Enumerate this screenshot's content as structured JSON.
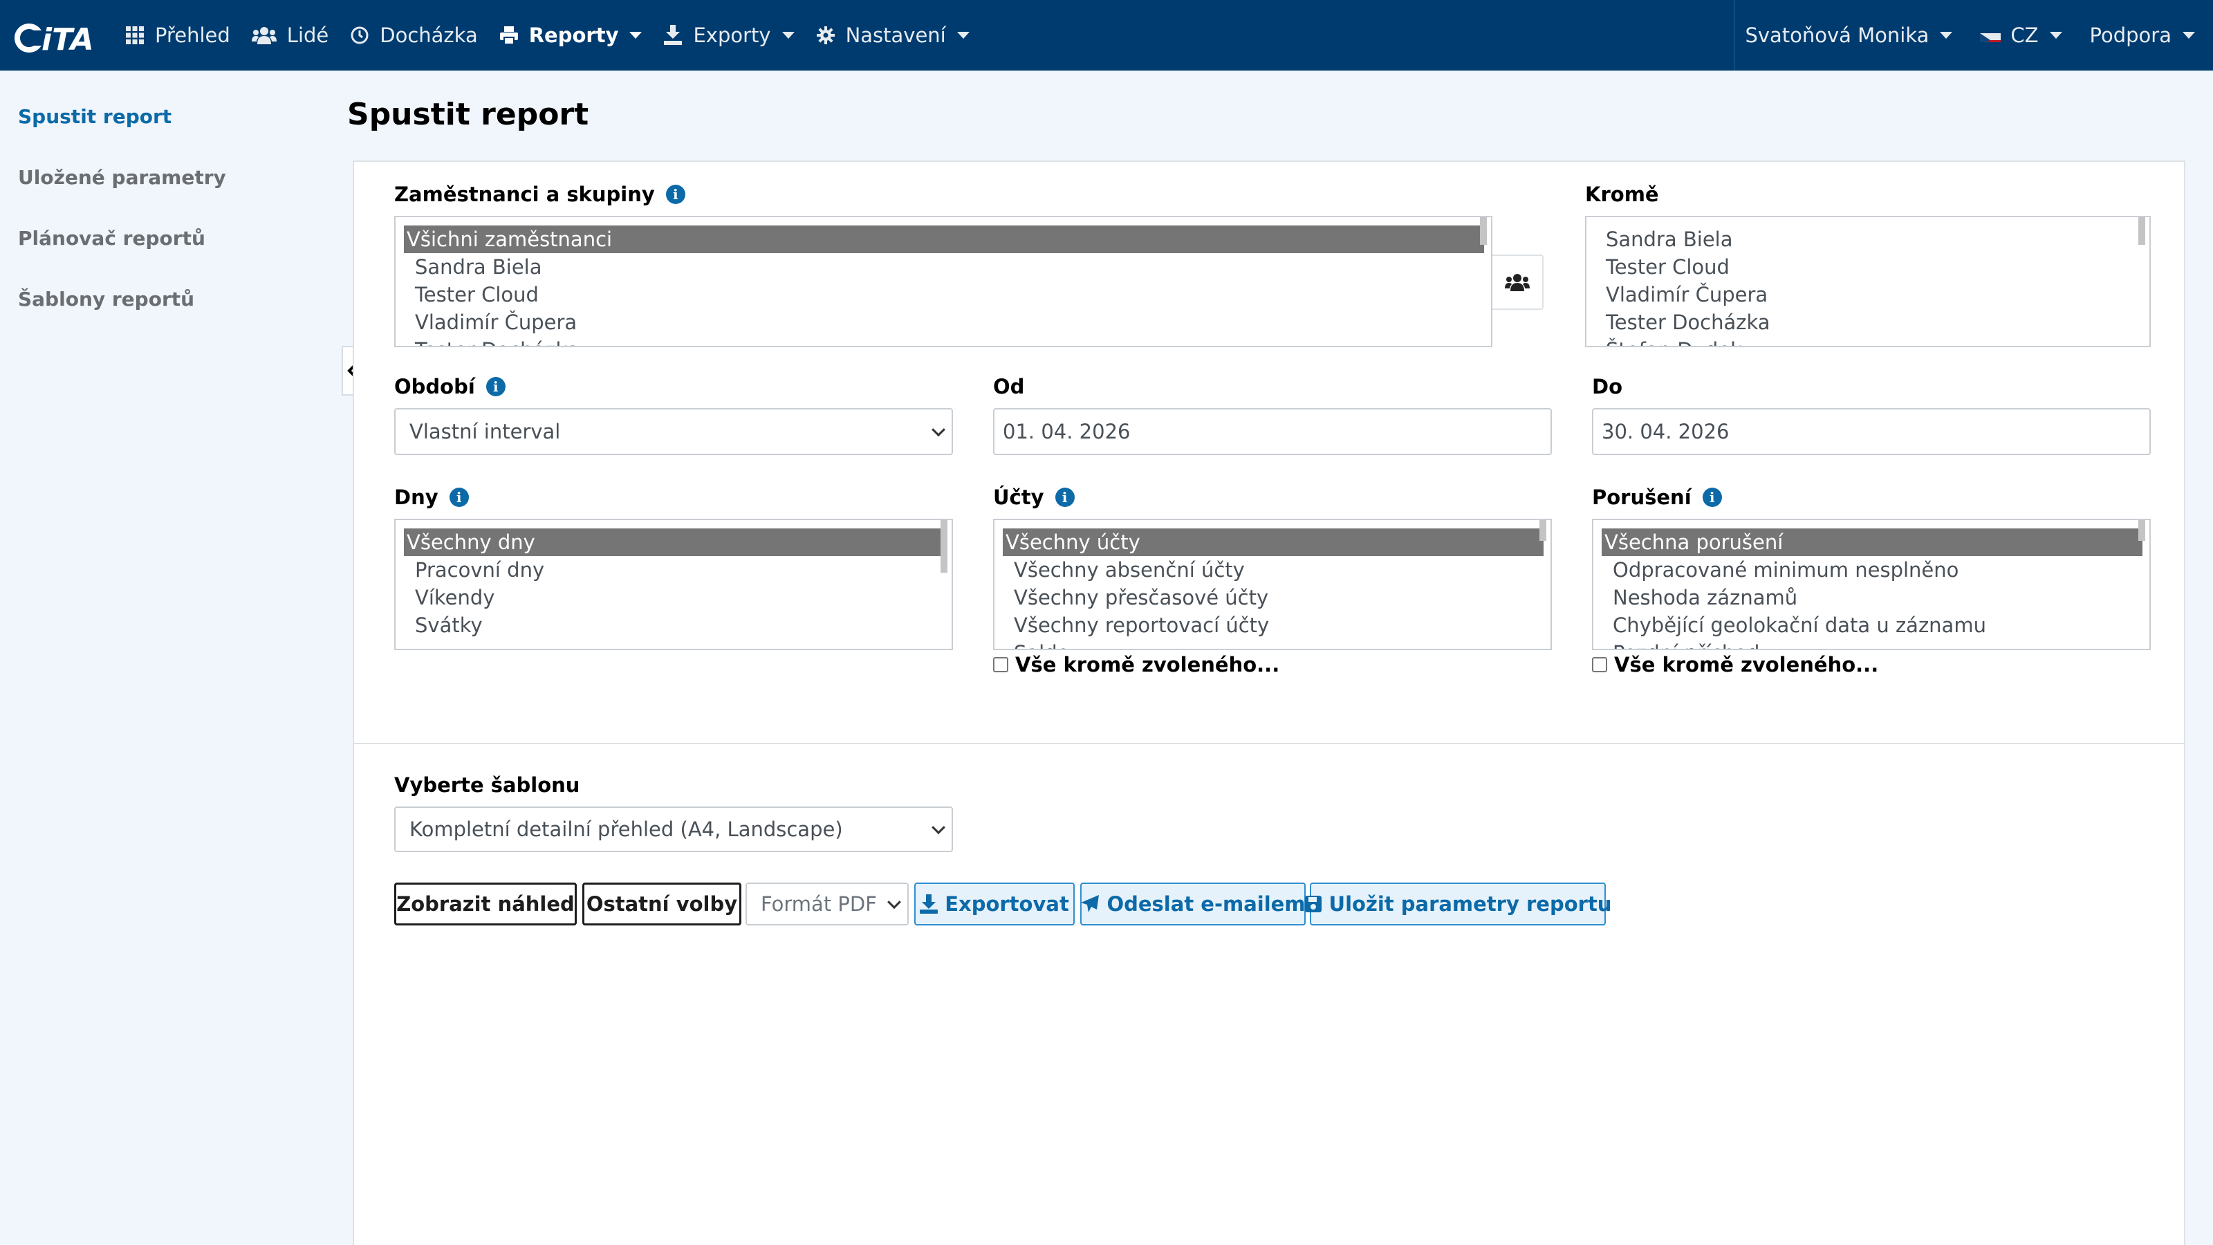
{
  "app": {
    "logo_text": "iTA"
  },
  "nav": {
    "items": [
      {
        "label": "Přehled",
        "icon": "grid-icon"
      },
      {
        "label": "Lidé",
        "icon": "users-icon"
      },
      {
        "label": "Docházka",
        "icon": "clock-icon"
      },
      {
        "label": "Reporty",
        "icon": "printer-icon",
        "active": true
      },
      {
        "label": "Exporty",
        "icon": "export-icon"
      },
      {
        "label": "Nastavení",
        "icon": "gear-icon"
      }
    ],
    "user": "Svatoňová Monika",
    "language": "CZ",
    "support": "Podpora"
  },
  "sidebar": {
    "items": [
      {
        "label": "Spustit report",
        "active": true
      },
      {
        "label": "Uložené parametry"
      },
      {
        "label": "Plánovač reportů"
      },
      {
        "label": "Šablony reportů"
      }
    ]
  },
  "page": {
    "title": "Spustit report"
  },
  "form": {
    "employees": {
      "label": "Zaměstnanci a skupiny",
      "options": [
        "Všichni zaměstnanci",
        "Sandra Biela",
        "Tester Cloud",
        "Vladimír Čupera",
        "Tester Docházka"
      ]
    },
    "except": {
      "label": "Kromě",
      "options": [
        "Sandra Biela",
        "Tester Cloud",
        "Vladimír Čupera",
        "Tester Docházka",
        "Štefan Dudek"
      ]
    },
    "period": {
      "label": "Období",
      "value": "Vlastní interval"
    },
    "from": {
      "label": "Od",
      "value": "01. 04. 2026"
    },
    "to": {
      "label": "Do",
      "value": "30. 04. 2026"
    },
    "days": {
      "label": "Dny",
      "options": [
        "Všechny dny",
        "Pracovní dny",
        "Víkendy",
        "Svátky"
      ]
    },
    "accounts": {
      "label": "Účty",
      "options": [
        "Všechny účty",
        "Všechny absenční účty",
        "Všechny přesčasové účty",
        "Všechny reportovací účty",
        "Saldo"
      ],
      "except_label": "Vše kromě zvoleného..."
    },
    "violations": {
      "label": "Porušení",
      "options": [
        "Všechna porušení",
        "Odpracované minimum nesplněno",
        "Neshoda záznamů",
        "Chybějící geolokační data u záznamu",
        "Pozdní příchod"
      ],
      "except_label": "Vše kromě zvoleného..."
    },
    "template": {
      "label": "Vyberte šablonu",
      "value": "Kompletní detailní přehled (A4, Landscape)"
    }
  },
  "actions": {
    "preview": "Zobrazit náhled",
    "other": "Ostatní volby",
    "format": "Formát PDF",
    "export": "Exportovat",
    "email": "Odeslat e-mailem",
    "save": "Uložit parametry reportu"
  },
  "colors": {
    "topbar": "#003b6f",
    "accent": "#0c6aa8",
    "selected": "#757575",
    "background": "#f0f6fc"
  }
}
